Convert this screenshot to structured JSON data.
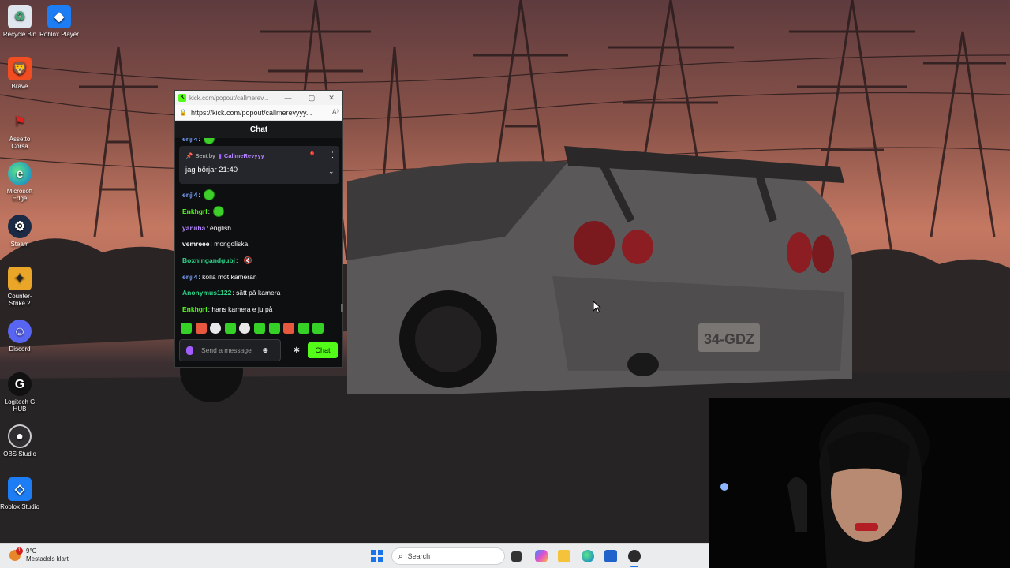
{
  "desktop_icons": [
    {
      "label": "Recycle Bin",
      "icon": "recycle-bin-icon"
    },
    {
      "label": "Roblox Player",
      "icon": "roblox-icon"
    },
    {
      "label": "Brave",
      "icon": "brave-icon"
    },
    {
      "label": "Assetto Corsa",
      "icon": "assetto-corsa-icon"
    },
    {
      "label": "Microsoft Edge",
      "icon": "edge-icon"
    },
    {
      "label": "Steam",
      "icon": "steam-icon"
    },
    {
      "label": "Counter-Strike 2",
      "icon": "counter-strike-icon"
    },
    {
      "label": "Discord",
      "icon": "discord-icon"
    },
    {
      "label": "Logitech G HUB",
      "icon": "logitech-icon"
    },
    {
      "label": "OBS Studio",
      "icon": "obs-icon"
    },
    {
      "label": "Roblox Studio",
      "icon": "roblox-studio-icon"
    }
  ],
  "browser": {
    "tab_title": "kick.com/popout/callmerev...",
    "url": "https://kick.com/popout/callmerevyyy..."
  },
  "chat": {
    "header": "Chat",
    "partial_top": {
      "user": "enji4",
      "suffix": ":"
    },
    "pinned": {
      "sent_by_label": "Sent by",
      "author": "CallmeRevyyy",
      "text": "jag börjar 21:40"
    },
    "messages": [
      {
        "user": "enji4",
        "text": "",
        "color": "#7aa3ff",
        "emote": "green"
      },
      {
        "user": "Enkhgrl",
        "text": "",
        "color": "#53fc18",
        "emote": "green"
      },
      {
        "user": "yaniiha",
        "text": "english",
        "color": "#b686ff",
        "emote": ""
      },
      {
        "user": "vemreee",
        "text": "mongoliska",
        "color": "#ffffff",
        "emote": ""
      },
      {
        "user": "Boxningandgubj",
        "text": "",
        "color": "#2ed48a",
        "emote": "mute"
      },
      {
        "user": "enji4",
        "text": "kolla mot kameran",
        "color": "#7aa3ff",
        "emote": ""
      },
      {
        "user": "Anonymus1122",
        "text": "sätt på kamera",
        "color": "#2ed48a",
        "emote": ""
      },
      {
        "user": "Enkhgrl",
        "text": "hans kamera e ju på",
        "color": "#53fc18",
        "emote": ""
      }
    ],
    "input_placeholder": "Send a message",
    "send_label": "Chat"
  },
  "taskbar": {
    "temperature": "9°C",
    "weather_desc": "Mestadels klart",
    "weather_badge": "1",
    "search_placeholder": "Search"
  },
  "colors": {
    "kick_green": "#53fc18",
    "accent_purple": "#a35cff"
  }
}
